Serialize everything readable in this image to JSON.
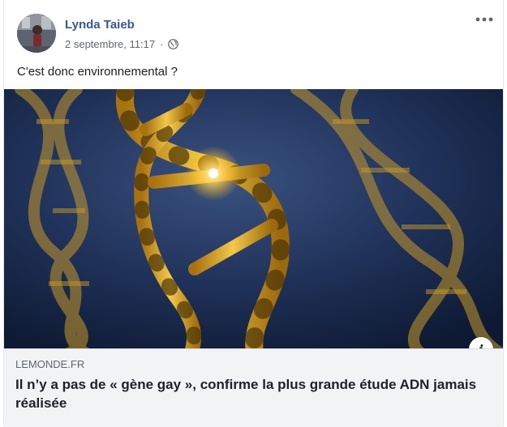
{
  "post": {
    "author": "Lynda Taieb",
    "timestamp": "2 septembre, 11:17",
    "separator": "·",
    "audience_icon": "globe-icon",
    "more_icon": "more-options-icon",
    "text": "C'est donc environnemental ?"
  },
  "link_preview": {
    "domain": "LEMONDE.FR",
    "headline": "Il n’y a pas de « gène gay », confirme la plus grande étude ADN jamais réalisée",
    "info_icon": "i"
  },
  "colors": {
    "author_link": "#385898",
    "meta_text": "#606770",
    "footer_bg": "#f2f3f5",
    "dna_gold": "#d8a425",
    "image_bg": "#1b2a4a"
  }
}
